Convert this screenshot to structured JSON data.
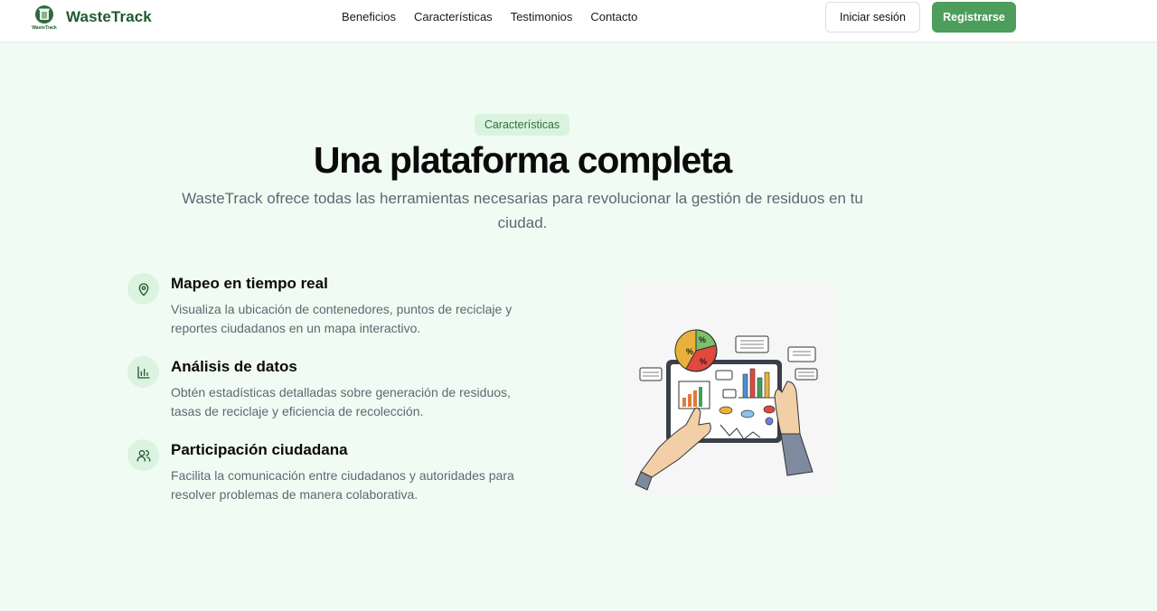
{
  "header": {
    "brand": "WasteTrack",
    "logo_caption": "WasteTrack",
    "nav": [
      "Beneficios",
      "Características",
      "Testimonios",
      "Contacto"
    ],
    "login_label": "Iniciar sesión",
    "register_label": "Registrarse",
    "accent_color": "#4d9d5c"
  },
  "hero": {
    "badge": "Características",
    "title": "Una plataforma completa",
    "subtitle": "WasteTrack ofrece todas las herramientas necesarias para revolucionar la gestión de residuos en tu ciudad."
  },
  "features": [
    {
      "icon": "map-pin-icon",
      "title": "Mapeo en tiempo real",
      "description": "Visualiza la ubicación de contenedores, puntos de reciclaje y reportes ciudadanos en un mapa interactivo."
    },
    {
      "icon": "bar-chart-icon",
      "title": "Análisis de datos",
      "description": "Obtén estadísticas detalladas sobre generación de residuos, tasas de reciclaje y eficiencia de recolección."
    },
    {
      "icon": "users-icon",
      "title": "Participación ciudadana",
      "description": "Facilita la comunicación entre ciudadanos y autoridades para resolver problemas de manera colaborativa."
    }
  ],
  "illustration": {
    "pie_labels": [
      "%",
      "%",
      "%"
    ]
  }
}
